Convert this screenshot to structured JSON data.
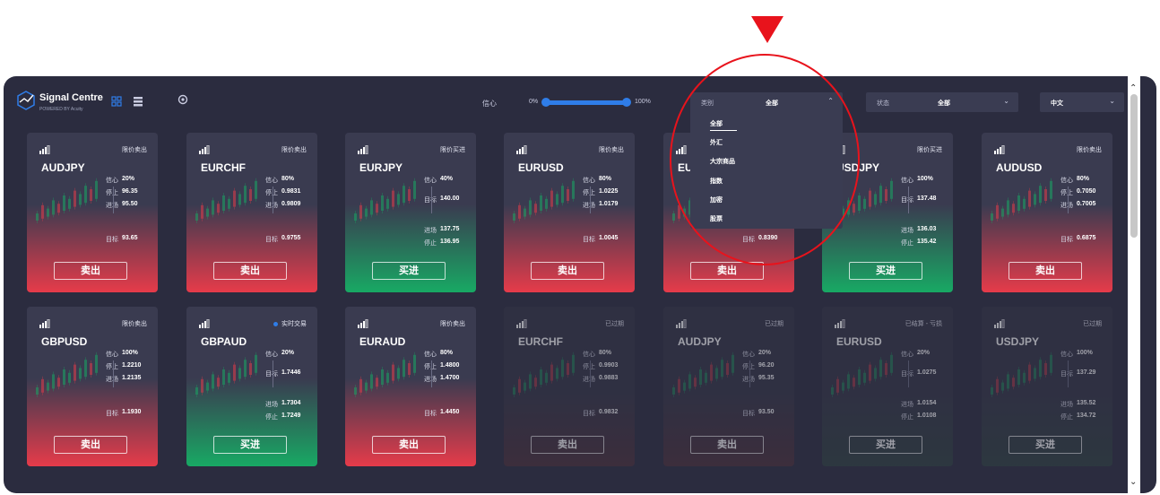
{
  "app": {
    "brand": "Signal Centre",
    "brand_sub": "POWERED BY Acuity",
    "confidence": {
      "label": "信心",
      "min": "0%",
      "max": "100%",
      "range": [
        0,
        100
      ]
    },
    "category_select": {
      "label": "类别",
      "value": "全部"
    },
    "status_select": {
      "label": "状态",
      "value": "全部"
    },
    "language_select": {
      "value": "中文"
    },
    "dropdown_items": [
      "全部",
      "外汇",
      "大宗商品",
      "指数",
      "加密",
      "股票"
    ]
  },
  "cards": [
    {
      "pair": "AUDJPY",
      "status": "限价卖出",
      "variant": "sell",
      "rows": [
        [
          "信心",
          "20%"
        ],
        [
          "停止",
          "96.35"
        ],
        [
          "进场",
          "95.50"
        ],
        [
          "目标",
          "93.65"
        ]
      ],
      "button": "卖出"
    },
    {
      "pair": "EURCHF",
      "status": "限价卖出",
      "variant": "sell",
      "rows": [
        [
          "信心",
          "80%"
        ],
        [
          "停止",
          "0.9831"
        ],
        [
          "进场",
          "0.9809"
        ],
        [
          "目标",
          "0.9755"
        ]
      ],
      "button": "卖出"
    },
    {
      "pair": "EURJPY",
      "status": "限价买进",
      "variant": "buy",
      "rows": [
        [
          "信心",
          "40%"
        ],
        [
          "目标",
          "140.00"
        ],
        [
          "进场",
          "137.75"
        ],
        [
          "停止",
          "136.95"
        ]
      ],
      "button": "买进"
    },
    {
      "pair": "EURUSD",
      "status": "限价卖出",
      "variant": "sell",
      "rows": [
        [
          "信心",
          "80%"
        ],
        [
          "停止",
          "1.0225"
        ],
        [
          "进场",
          "1.0179"
        ],
        [
          "目标",
          "1.0045"
        ]
      ],
      "button": "卖出"
    },
    {
      "pair": "EURGBP",
      "status": "限价卖出",
      "variant": "sell",
      "rows": [
        [
          "信心",
          ""
        ],
        [
          "停止",
          ""
        ],
        [
          "进场",
          ""
        ],
        [
          "目标",
          "0.8390"
        ]
      ],
      "button": "卖出"
    },
    {
      "pair": "USDJPY",
      "status": "限价买进",
      "variant": "buy",
      "rows": [
        [
          "信心",
          "100%"
        ],
        [
          "目标",
          "137.48"
        ],
        [
          "进场",
          "136.03"
        ],
        [
          "停止",
          "135.42"
        ]
      ],
      "button": "买进"
    },
    {
      "pair": "AUDUSD",
      "status": "限价卖出",
      "variant": "sell",
      "rows": [
        [
          "信心",
          "80%"
        ],
        [
          "停止",
          "0.7050"
        ],
        [
          "进场",
          "0.7005"
        ],
        [
          "目标",
          "0.6875"
        ]
      ],
      "button": "卖出"
    },
    {
      "pair": "GBPUSD",
      "status": "限价卖出",
      "variant": "sell",
      "rows": [
        [
          "信心",
          "100%"
        ],
        [
          "停止",
          "1.2210"
        ],
        [
          "进场",
          "1.2135"
        ],
        [
          "目标",
          "1.1930"
        ]
      ],
      "button": "卖出"
    },
    {
      "pair": "GBPAUD",
      "status": "实时交易",
      "variant": "buy",
      "live": true,
      "rows": [
        [
          "信心",
          "20%"
        ],
        [
          "目标",
          "1.7446"
        ],
        [
          "进场",
          "1.7304"
        ],
        [
          "停止",
          "1.7249"
        ]
      ],
      "button": "买进"
    },
    {
      "pair": "EURAUD",
      "status": "限价卖出",
      "variant": "sell",
      "rows": [
        [
          "信心",
          "80%"
        ],
        [
          "停止",
          "1.4800"
        ],
        [
          "进场",
          "1.4700"
        ],
        [
          "目标",
          "1.4450"
        ]
      ],
      "button": "卖出"
    },
    {
      "pair": "EURCHF",
      "status": "已过期",
      "variant": "exp-sell",
      "dim": true,
      "rows": [
        [
          "信心",
          "80%"
        ],
        [
          "停止",
          "0.9903"
        ],
        [
          "进场",
          "0.9883"
        ],
        [
          "目标",
          "0.9832"
        ]
      ],
      "button": "卖出"
    },
    {
      "pair": "AUDJPY",
      "status": "已过期",
      "variant": "exp-sell",
      "dim": true,
      "rows": [
        [
          "信心",
          "20%"
        ],
        [
          "停止",
          "96.20"
        ],
        [
          "进场",
          "95.35"
        ],
        [
          "目标",
          "93.50"
        ]
      ],
      "button": "卖出"
    },
    {
      "pair": "EURUSD",
      "status": "已结算 - 亏损",
      "variant": "exp-buy",
      "dim": true,
      "rows": [
        [
          "信心",
          "20%"
        ],
        [
          "目标",
          "1.0275"
        ],
        [
          "进场",
          "1.0154"
        ],
        [
          "停止",
          "1.0108"
        ]
      ],
      "button": "买进"
    },
    {
      "pair": "USDJPY",
      "status": "已过期",
      "variant": "exp-buy",
      "dim": true,
      "rows": [
        [
          "信心",
          "100%"
        ],
        [
          "目标",
          "137.29"
        ],
        [
          "进场",
          "135.52"
        ],
        [
          "停止",
          "134.72"
        ]
      ],
      "button": "买进"
    }
  ]
}
